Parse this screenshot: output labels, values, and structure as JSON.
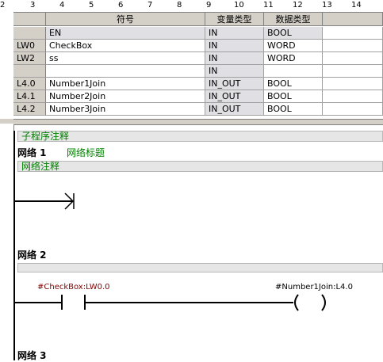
{
  "ruler": {
    "ticks": [
      "2",
      "3",
      "4",
      "5",
      "6",
      "7",
      "8",
      "9",
      "10",
      "11",
      "12",
      "13",
      "14"
    ]
  },
  "variable_table": {
    "columns": [
      "符号",
      "变量类型",
      "数据类型"
    ],
    "rows": [
      {
        "address": "",
        "symbol": "EN",
        "var_type": "IN",
        "data_type": "BOOL"
      },
      {
        "address": "LW0",
        "symbol": "CheckBox",
        "var_type": "IN",
        "data_type": "WORD"
      },
      {
        "address": "LW2",
        "symbol": "ss",
        "var_type": "IN",
        "data_type": "WORD"
      },
      {
        "address": "",
        "symbol": "",
        "var_type": "IN",
        "data_type": ""
      },
      {
        "address": "L4.0",
        "symbol": "Number1Join",
        "var_type": "IN_OUT",
        "data_type": "BOOL"
      },
      {
        "address": "L4.1",
        "symbol": "Number2Join",
        "var_type": "IN_OUT",
        "data_type": "BOOL"
      },
      {
        "address": "L4.2",
        "symbol": "Number3Join",
        "var_type": "IN_OUT",
        "data_type": "BOOL"
      }
    ]
  },
  "program": {
    "subroutine_comment": "子程序注释",
    "network1": {
      "label": "网络 1",
      "title": "网络标题",
      "comment": "网络注释"
    },
    "network2": {
      "label": "网络 2",
      "contact_operand": "#CheckBox:LW0.0",
      "coil_operand": "#Number1Join:L4.0"
    },
    "network3": {
      "label": "网络 3"
    }
  },
  "colors": {
    "comment_green": "#008000",
    "operand_red": "#800000",
    "chrome_gray": "#d4d0c8"
  }
}
